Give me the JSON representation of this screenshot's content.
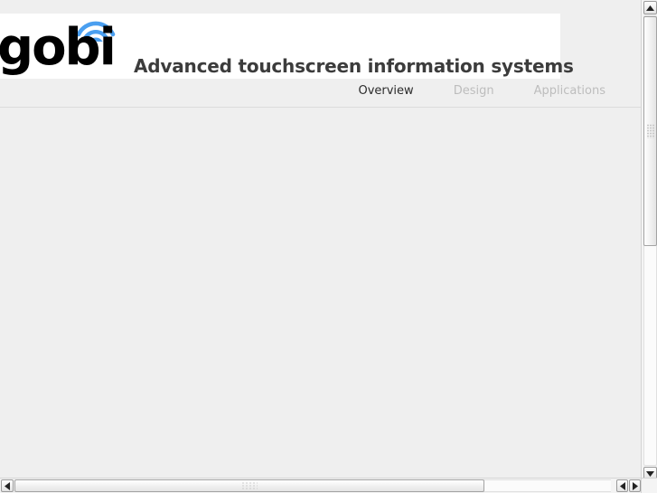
{
  "page": {
    "background_color": "#efefef",
    "content_background": "#ffffff"
  },
  "header": {
    "logo_text": "gobi",
    "logo_color": "#000000",
    "wifi_icon": "wifi-arcs-icon",
    "wifi_color": "#4a9ff0",
    "tagline": "Advanced touchscreen information systems",
    "tagline_color": "#3c3c3c"
  },
  "nav": {
    "items": [
      {
        "label": "Overview",
        "active": true
      },
      {
        "label": "Design",
        "active": false
      },
      {
        "label": "Applications",
        "active": false
      }
    ],
    "active_color": "#2b2b2b",
    "inactive_color": "#bdbdbd"
  },
  "scrollbars": {
    "vertical": {
      "up_arrow_icon": "triangle-up-icon",
      "down_arrow_icon": "triangle-down-icon",
      "grip_icon": "grip-dots-icon"
    },
    "horizontal": {
      "left_arrow_icon": "triangle-left-icon",
      "right_arrow_icon": "triangle-right-icon",
      "grip_icon": "grip-dots-icon"
    }
  }
}
